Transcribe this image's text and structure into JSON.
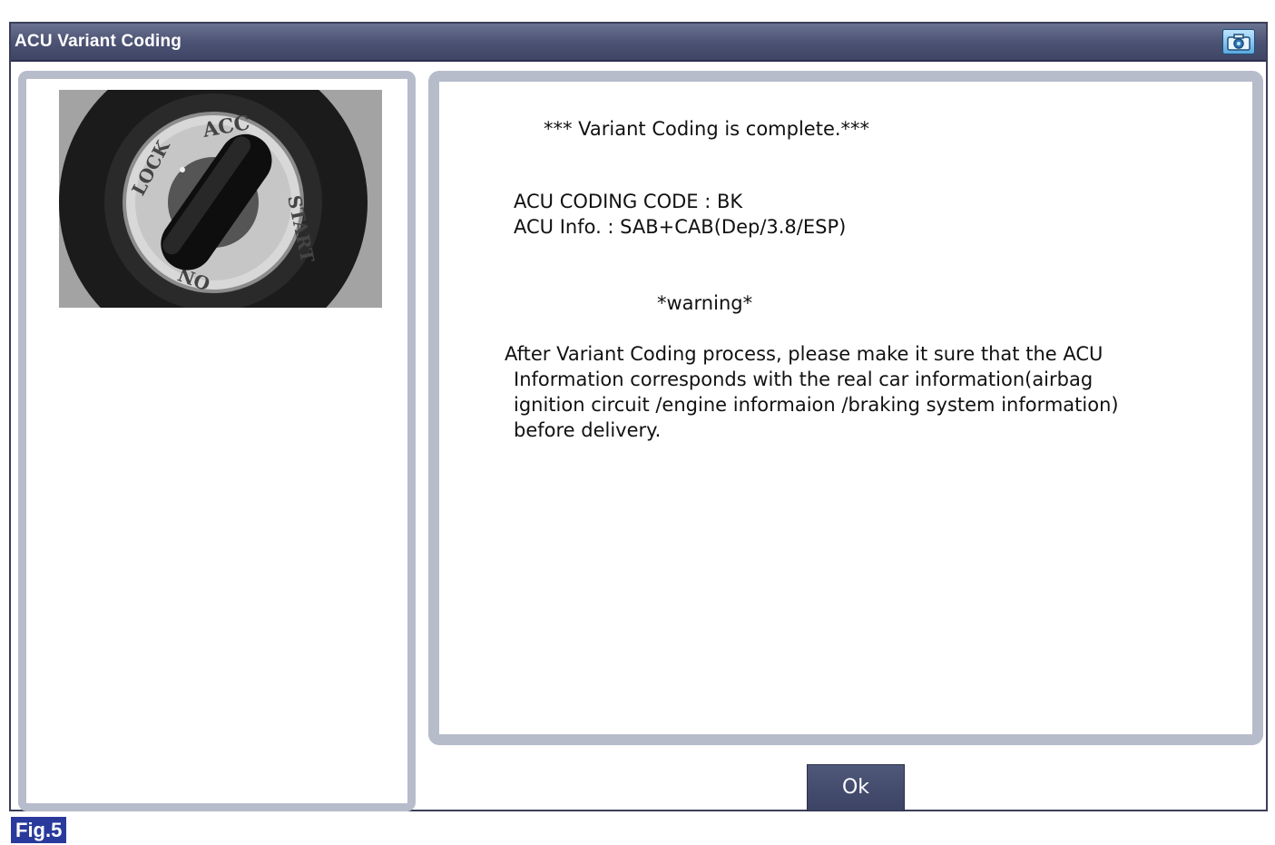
{
  "window": {
    "title": "ACU Variant Coding",
    "camera_icon": "camera-icon"
  },
  "switch_image": {
    "icon": "ignition-switch-photo",
    "labels": {
      "lock": "LOCK",
      "acc": "ACC",
      "on": "ON",
      "start": "START"
    }
  },
  "message": {
    "header": "*** Variant Coding is complete.***",
    "coding_code": "ACU CODING CODE :  BK",
    "info": "ACU Info. : SAB+CAB(Dep/3.8/ESP)",
    "warning_title": "*warning*",
    "warning_lines": [
      "After Variant Coding process, please make it sure that the ACU",
      "Information corresponds with the real car information(airbag",
      "ignition circuit /engine informaion /braking system information)",
      "before delivery."
    ]
  },
  "buttons": {
    "ok": "Ok"
  },
  "figure_label": "Fig.5",
  "colors": {
    "titlebar": "#4c5374",
    "panel_border": "#b7bccb",
    "button": "#454c6e",
    "fig_label": "#2a3a9c"
  }
}
